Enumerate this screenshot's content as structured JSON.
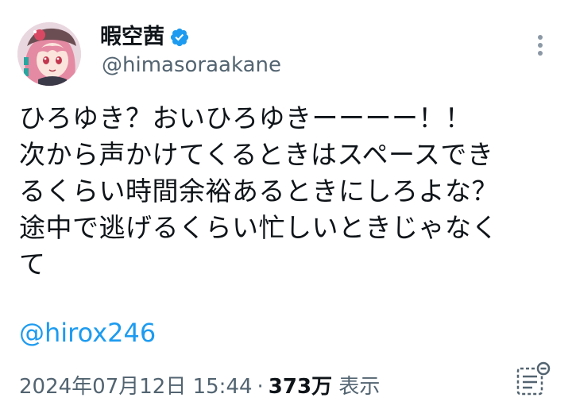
{
  "author": {
    "display_name": "暇空茜",
    "handle": "@himasoraakane",
    "verified": true
  },
  "tweet": {
    "lines": [
      "ひろゆき？おいひろゆきーーーー！！",
      "次から声かけてくるときはスペースでき",
      "るくらい時間余裕あるときにしろよな？",
      "途中で逃げるくらい忙しいときじゃなく",
      "て"
    ],
    "mention": "@hirox246"
  },
  "meta": {
    "timestamp": "2024年07月12日 15:44",
    "separator": "·",
    "views_count": "373万",
    "views_label": "表示"
  },
  "colors": {
    "link": "#1d9bf0",
    "secondary_text": "#536471",
    "verified_badge": "#1d9bf0"
  },
  "icons": {
    "more": "more-dots-icon",
    "verified": "verified-badge-icon",
    "analytics": "analytics-icon"
  }
}
